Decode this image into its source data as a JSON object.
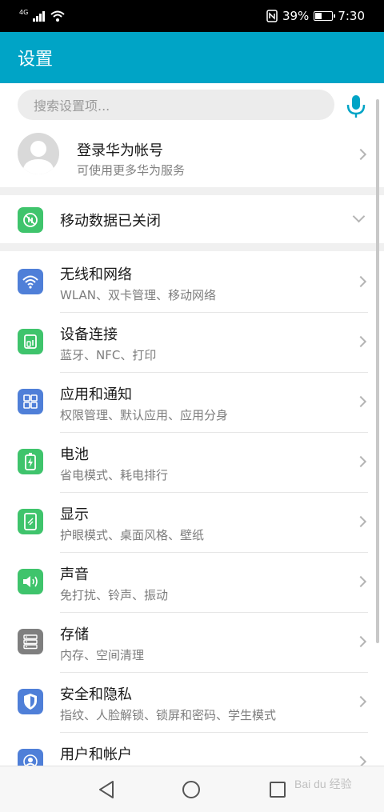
{
  "status_bar": {
    "network": "4G",
    "battery_percent": "39%",
    "battery_level": 0.39,
    "time": "7:30"
  },
  "app_bar": {
    "title": "设置"
  },
  "search": {
    "placeholder": "搜索设置项..."
  },
  "account": {
    "title": "登录华为帐号",
    "subtitle": "可使用更多华为服务"
  },
  "mobile_data": {
    "title": "移动数据已关闭"
  },
  "settings": [
    {
      "title": "无线和网络",
      "subtitle": "WLAN、双卡管理、移动网络",
      "icon": "wifi-icon",
      "color": "#4f7fd8"
    },
    {
      "title": "设备连接",
      "subtitle": "蓝牙、NFC、打印",
      "icon": "device-connect-icon",
      "color": "#3fc46c"
    },
    {
      "title": "应用和通知",
      "subtitle": "权限管理、默认应用、应用分身",
      "icon": "apps-icon",
      "color": "#4f7fd8"
    },
    {
      "title": "电池",
      "subtitle": "省电模式、耗电排行",
      "icon": "battery-icon",
      "color": "#3fc46c"
    },
    {
      "title": "显示",
      "subtitle": "护眼模式、桌面风格、壁纸",
      "icon": "display-icon",
      "color": "#3fc46c"
    },
    {
      "title": "声音",
      "subtitle": "免打扰、铃声、振动",
      "icon": "sound-icon",
      "color": "#3fc46c"
    },
    {
      "title": "存储",
      "subtitle": "内存、空间清理",
      "icon": "storage-icon",
      "color": "#7f7f7f"
    },
    {
      "title": "安全和隐私",
      "subtitle": "指纹、人脸解锁、锁屏和密码、学生模式",
      "icon": "shield-icon",
      "color": "#4f7fd8"
    },
    {
      "title": "用户和帐户",
      "subtitle": "",
      "icon": "user-icon",
      "color": "#4f7fd8"
    }
  ],
  "watermark": "Bai du 经验"
}
